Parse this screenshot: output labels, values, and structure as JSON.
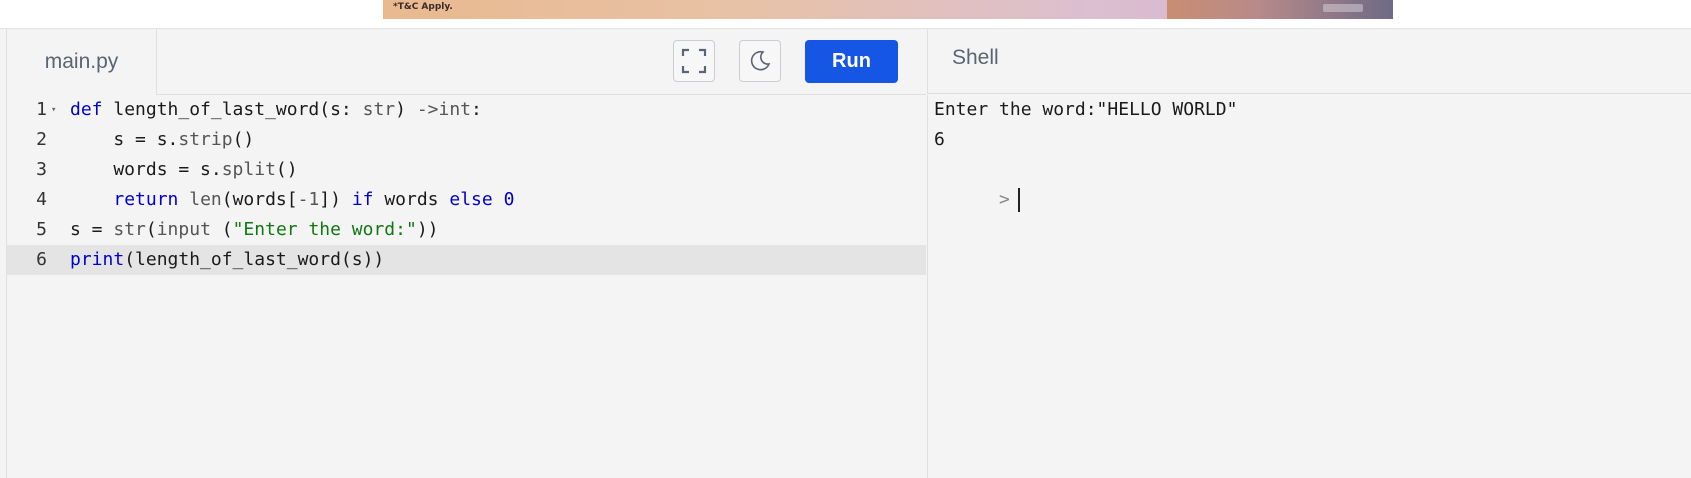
{
  "ad": {
    "text": "*T&C Apply."
  },
  "editor": {
    "file_tab": "main.py",
    "run_label": "Run",
    "fullscreen_icon": "fullscreen-icon",
    "theme_icon": "moon-icon",
    "lines": [
      {
        "num": "1",
        "segments": [
          [
            "kw",
            "def"
          ],
          [
            "fn",
            " length_of_last_word(s: "
          ],
          [
            "builtin",
            "str"
          ],
          [
            "fn",
            ") "
          ],
          [
            "op",
            "->"
          ],
          [
            "builtin",
            "int"
          ],
          [
            "fn",
            ":"
          ]
        ]
      },
      {
        "num": "2",
        "segments": [
          [
            "fn",
            "    s = s."
          ],
          [
            "builtin",
            "strip"
          ],
          [
            "fn",
            "()"
          ]
        ]
      },
      {
        "num": "3",
        "segments": [
          [
            "fn",
            "    words = s."
          ],
          [
            "builtin",
            "split"
          ],
          [
            "fn",
            "()"
          ]
        ]
      },
      {
        "num": "4",
        "segments": [
          [
            "fn",
            "    "
          ],
          [
            "kw",
            "return"
          ],
          [
            "builtin",
            " len"
          ],
          [
            "fn",
            "(words["
          ],
          [
            "op",
            "-1"
          ],
          [
            "fn",
            "]) "
          ],
          [
            "kw",
            "if"
          ],
          [
            "fn",
            " words "
          ],
          [
            "kw",
            "else"
          ],
          [
            "fn",
            " "
          ],
          [
            "num",
            "0"
          ]
        ]
      },
      {
        "num": "5",
        "segments": [
          [
            "fn",
            "s = "
          ],
          [
            "builtin",
            "str"
          ],
          [
            "fn",
            "("
          ],
          [
            "builtin",
            "input"
          ],
          [
            "fn",
            " ("
          ],
          [
            "str",
            "\"Enter the word:\""
          ],
          [
            "fn",
            "))"
          ]
        ]
      },
      {
        "num": "6",
        "segments": [
          [
            "kw",
            "print"
          ],
          [
            "fn",
            "(length_of_last_word(s))"
          ]
        ]
      }
    ]
  },
  "shell": {
    "title": "Shell",
    "output": [
      "Enter the word:\"HELLO WORLD\"",
      "6"
    ],
    "prompt": ">"
  }
}
